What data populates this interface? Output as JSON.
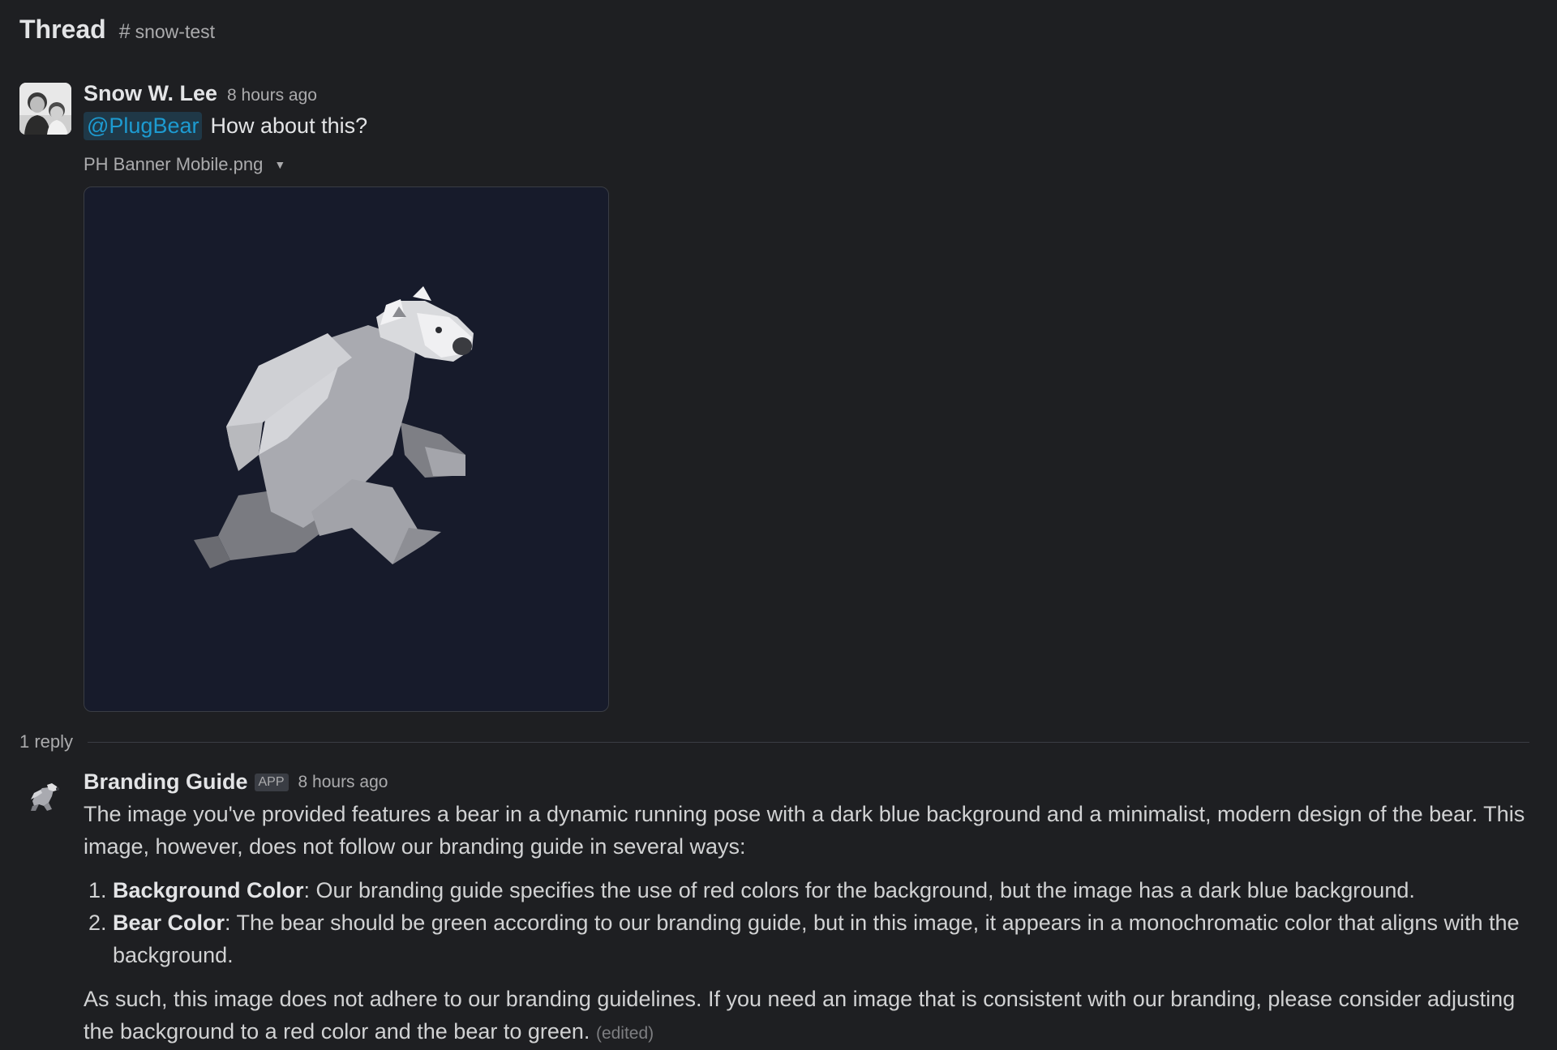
{
  "header": {
    "title": "Thread",
    "channel_hash": "#",
    "channel_name": "snow-test"
  },
  "message1": {
    "author": "Snow W. Lee",
    "timestamp": "8 hours ago",
    "mention": "@PlugBear",
    "text": "How about this?",
    "file_name": "PH Banner Mobile.png",
    "attachment_icon": "bear-running-illustration"
  },
  "thread": {
    "reply_count": "1 reply"
  },
  "message2": {
    "author": "Branding Guide",
    "badge": "APP",
    "timestamp": "8 hours ago",
    "intro": "The image you've provided features a bear in a dynamic running pose with a dark blue background and a minimalist, modern design of the bear. This image, however, does not follow our branding guide in several ways:",
    "items": [
      {
        "term": "Background Color",
        "text": ": Our branding guide specifies the use of red colors for the background, but the image has a dark blue background."
      },
      {
        "term": "Bear Color",
        "text": ": The bear should be green according to our branding guide, but in this image, it appears in a monochromatic color that aligns with the background."
      }
    ],
    "conclusion": "As such, this image does not adhere to our branding guidelines. If you need an image that is consistent with our branding, please consider adjusting the background to a red color and the bear to green.",
    "edited": "(edited)"
  },
  "colors": {
    "background": "#1e1f22",
    "mention": "#1d9bd1",
    "image_background": "#171b2b"
  }
}
